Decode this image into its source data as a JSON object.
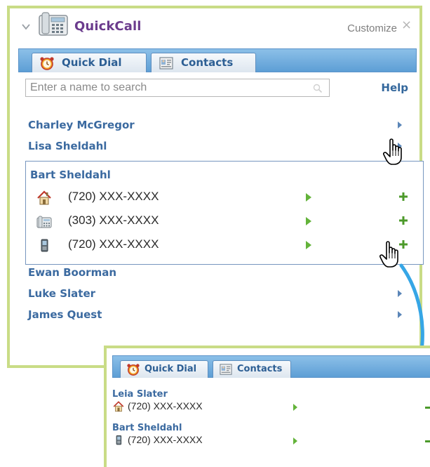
{
  "header": {
    "title": "QuickCall",
    "customize_label": "Customize",
    "close_glyph": "×",
    "icons": {
      "collapse": "chevron-down-icon",
      "app": "desk-phone-icon"
    }
  },
  "tabs": [
    {
      "label": "Quick Dial",
      "icon": "alarm-clock-icon",
      "selected": true
    },
    {
      "label": "Contacts",
      "icon": "contact-card-icon",
      "selected": false
    }
  ],
  "search": {
    "placeholder": "Enter a name to search",
    "help_label": "Help"
  },
  "contacts": [
    {
      "name": "Charley McGregor",
      "expanded": false
    },
    {
      "name": "Lisa Sheldahl",
      "expanded": false
    },
    {
      "name": "Bart Sheldahl",
      "expanded": true,
      "phones": [
        {
          "type": "home",
          "icon": "house-icon",
          "number": "(720) XXX-XXXX"
        },
        {
          "type": "work",
          "icon": "desk-phone-icon",
          "number": "(303) XXX-XXXX"
        },
        {
          "type": "mobile",
          "icon": "mobile-phone-icon",
          "number": "(720) XXX-XXXX"
        }
      ]
    },
    {
      "name": "Ewan Boorman",
      "expanded": false
    },
    {
      "name": "Luke Slater",
      "expanded": false
    },
    {
      "name": "James Quest",
      "expanded": false
    }
  ],
  "quick_dial_preview": {
    "tabs": [
      {
        "label": "Quick Dial",
        "icon": "alarm-clock-icon",
        "selected": true
      },
      {
        "label": "Contacts",
        "icon": "contact-card-icon",
        "selected": false
      }
    ],
    "entries": [
      {
        "name": "Leia Slater",
        "icon": "house-icon",
        "number": "(720) XXX-XXXX"
      },
      {
        "name": "Bart Sheldahl",
        "icon": "mobile-phone-icon",
        "number": "(720) XXX-XXXX"
      }
    ]
  },
  "colors": {
    "widget_border": "#c9dc86",
    "tab_strip": "#6aa7db",
    "title": "#6b3c8d",
    "contact_name": "#3b6aa0",
    "action_green": "#4c9a2a",
    "flow_arrow": "#36a6e6"
  }
}
